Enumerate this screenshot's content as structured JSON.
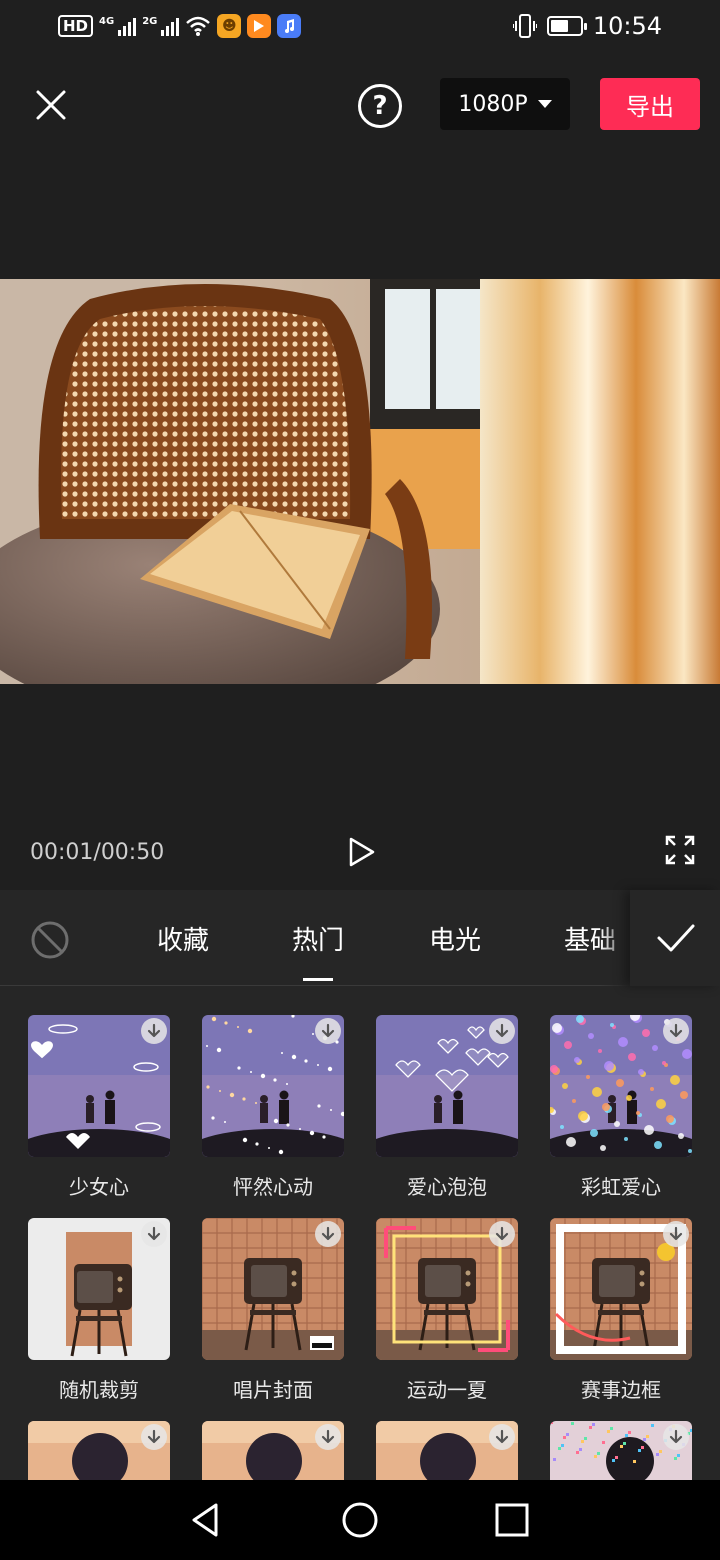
{
  "status_bar": {
    "hd_badge": "HD",
    "signal_1_label": "4G",
    "signal_2_label": "2G",
    "time": "10:54",
    "battery_level": 0.6,
    "icons": [
      "hd-icon",
      "signal-4g-icon",
      "signal-2g-icon",
      "wifi-icon",
      "app-notification-icon",
      "video-app-icon",
      "music-app-icon",
      "vibrate-icon",
      "battery-icon"
    ]
  },
  "toolbar": {
    "close_icon": "close-icon",
    "help_label": "?",
    "resolution": "1080P",
    "export_label": "导出"
  },
  "player": {
    "time_display": "00:01/00:50",
    "play_icon": "play-icon",
    "fullscreen_icon": "fullscreen-icon"
  },
  "effects": {
    "tabs": [
      {
        "label": "收藏",
        "active": false
      },
      {
        "label": "热门",
        "active": true
      },
      {
        "label": "电光",
        "active": false
      },
      {
        "label": "基础",
        "active": false
      }
    ],
    "items": [
      {
        "label": "少女心",
        "theme": "night-hearts"
      },
      {
        "label": "怦然心动",
        "theme": "night-sparkles"
      },
      {
        "label": "爱心泡泡",
        "theme": "night-bubbles"
      },
      {
        "label": "彩虹爱心",
        "theme": "rainbow-hearts"
      },
      {
        "label": "随机裁剪",
        "theme": "tv-crop"
      },
      {
        "label": "唱片封面",
        "theme": "tv-album"
      },
      {
        "label": "运动一夏",
        "theme": "tv-sport"
      },
      {
        "label": "赛事边框",
        "theme": "tv-frame"
      },
      {
        "label": "",
        "theme": "sunset"
      },
      {
        "label": "",
        "theme": "sunset"
      },
      {
        "label": "",
        "theme": "sunset"
      },
      {
        "label": "",
        "theme": "confetti"
      }
    ]
  },
  "colors": {
    "accent": "#fe2c55",
    "background": "#1f1f1f",
    "panel": "#262626"
  }
}
